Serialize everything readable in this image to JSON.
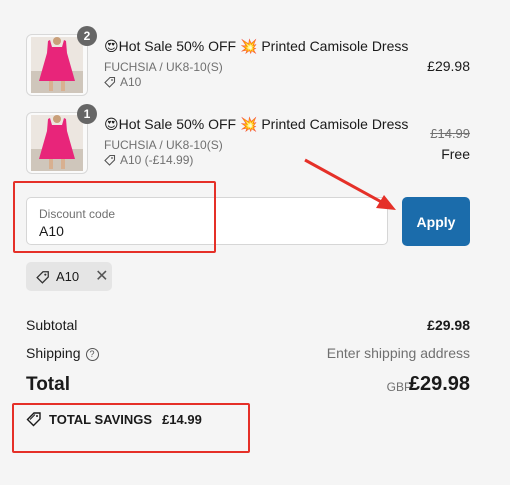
{
  "items": [
    {
      "quantity": "2",
      "title": "Hot Sale 50% OFF Printed Camisole Dress",
      "title_emoji_left": "😍",
      "title_emoji_mid": "💥",
      "variant": "FUCHSIA / UK8-10(S)",
      "discount": "A10",
      "price": "£29.98"
    },
    {
      "quantity": "1",
      "title": "Hot Sale 50% OFF Printed Camisole Dress",
      "title_emoji_left": "😍",
      "title_emoji_mid": "💥",
      "variant": "FUCHSIA / UK8-10(S)",
      "discount": "A10 (-£14.99)",
      "original_price": "£14.99",
      "price": "Free"
    }
  ],
  "discount_field": {
    "label": "Discount code",
    "value": "A10"
  },
  "apply_label": "Apply",
  "applied_code": "A10",
  "summary": {
    "subtotal_label": "Subtotal",
    "subtotal_value": "£29.98",
    "shipping_label": "Shipping",
    "shipping_value": "Enter shipping address",
    "total_label": "Total",
    "total_currency": "GBP",
    "total_value": "£29.98",
    "savings_label": "TOTAL SAVINGS",
    "savings_value": "£14.99"
  },
  "colors": {
    "accent": "#1b6cab",
    "annotation": "#e53028",
    "product": "#e8257a"
  }
}
